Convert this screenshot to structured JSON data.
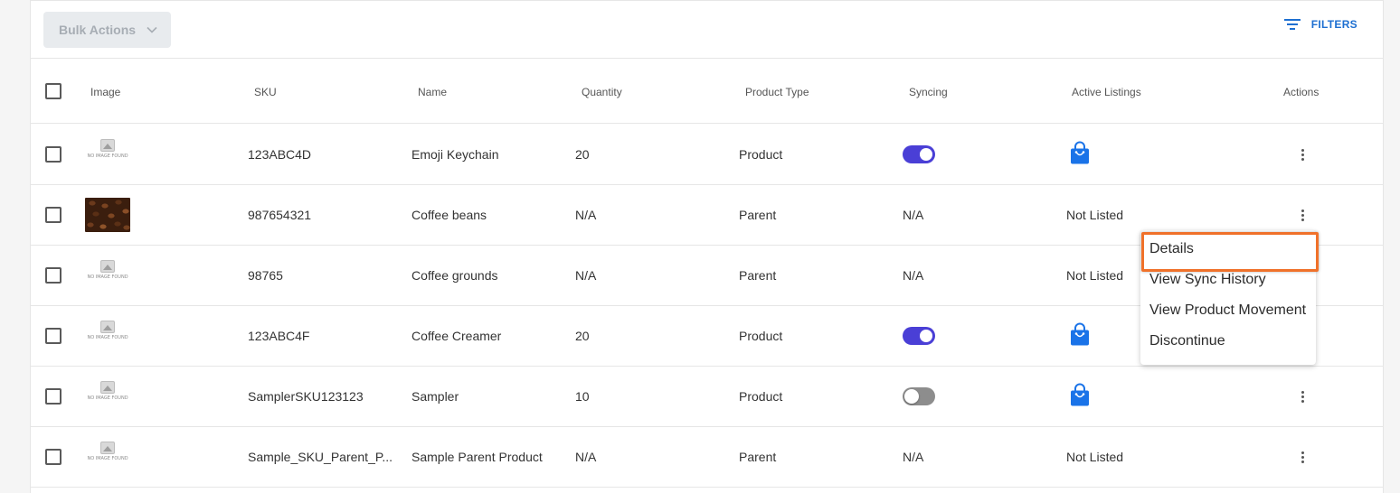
{
  "toolbar": {
    "bulk_actions_label": "Bulk Actions",
    "filters_label": "FILTERS"
  },
  "columns": [
    "Image",
    "SKU",
    "Name",
    "Quantity",
    "Product Type",
    "Syncing",
    "Active Listings",
    "Actions"
  ],
  "no_image_text": "NO IMAGE FOUND",
  "rows": [
    {
      "sku": "123ABC4D",
      "name": "Emoji Keychain",
      "quantity": "20",
      "product_type": "Product",
      "syncing": "on",
      "active_listings": "bag"
    },
    {
      "sku": "987654321",
      "name": "Coffee beans",
      "quantity": "N/A",
      "product_type": "Parent",
      "syncing": "N/A",
      "active_listings": "Not Listed"
    },
    {
      "sku": "98765",
      "name": "Coffee grounds",
      "quantity": "N/A",
      "product_type": "Parent",
      "syncing": "N/A",
      "active_listings": "Not Listed"
    },
    {
      "sku": "123ABC4F",
      "name": "Coffee Creamer",
      "quantity": "20",
      "product_type": "Product",
      "syncing": "on",
      "active_listings": "bag"
    },
    {
      "sku": "SamplerSKU123123",
      "name": "Sampler",
      "quantity": "10",
      "product_type": "Product",
      "syncing": "off",
      "active_listings": "bag"
    },
    {
      "sku": "Sample_SKU_Parent_P...",
      "name": "Sample Parent Product",
      "quantity": "N/A",
      "product_type": "Parent",
      "syncing": "N/A",
      "active_listings": "Not Listed"
    }
  ],
  "actions_menu": {
    "items": [
      "Details",
      "View Sync History",
      "View Product Movement",
      "Discontinue"
    ]
  },
  "colors": {
    "accent": "#1d6fd1",
    "toggle_on": "#4a3fd6",
    "bag": "#1a73e8",
    "highlight": "#f0712a"
  },
  "icons": {
    "filters": "filter-lines-icon",
    "bulk_chevron": "chevron-down-icon",
    "active_listing": "shopping-bag-icon",
    "row_actions": "more-vert-icon"
  }
}
